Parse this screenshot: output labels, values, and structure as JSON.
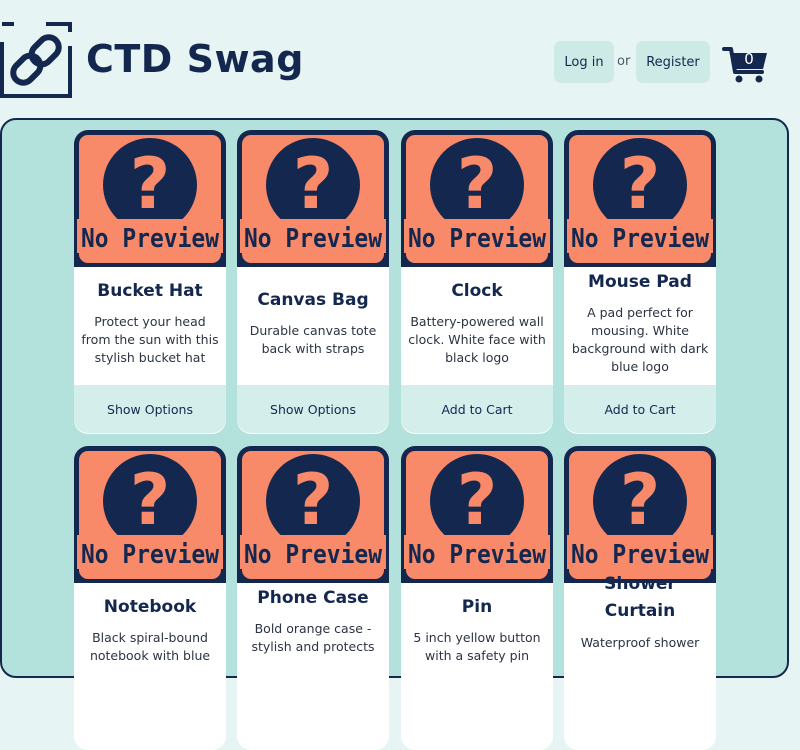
{
  "header": {
    "title": "CTD Swag",
    "login_label": "Log in",
    "or_text": "or",
    "register_label": "Register",
    "cart_count": "0"
  },
  "placeholder_image": {
    "question_mark": "?",
    "text": "No Preview"
  },
  "products": [
    {
      "name": "Bucket Hat",
      "description": "Protect your head from the sun with this stylish bucket hat",
      "action": "Show Options"
    },
    {
      "name": "Canvas Bag",
      "description": "Durable canvas tote back with straps",
      "action": "Show Options"
    },
    {
      "name": "Clock",
      "description": "Battery-powered wall clock. White face with black logo",
      "action": "Add to Cart"
    },
    {
      "name": "Mouse Pad",
      "description": "A pad perfect for mousing. White background with dark blue logo",
      "action": "Add to Cart"
    },
    {
      "name": "Notebook",
      "description": "Black spiral-bound notebook with blue",
      "action": ""
    },
    {
      "name": "Phone Case",
      "description": "Bold orange case - stylish and protects",
      "action": ""
    },
    {
      "name": "Pin",
      "description": "5 inch yellow button with a safety pin",
      "action": ""
    },
    {
      "name": "Shower Curtain",
      "description": "Waterproof shower",
      "action": ""
    }
  ],
  "colors": {
    "navy": "#14284f",
    "salmon": "#f88a6a",
    "page_bg": "#e6f5f3",
    "panel_bg": "#b3e1dc",
    "button_bg": "#d3eeeb"
  }
}
